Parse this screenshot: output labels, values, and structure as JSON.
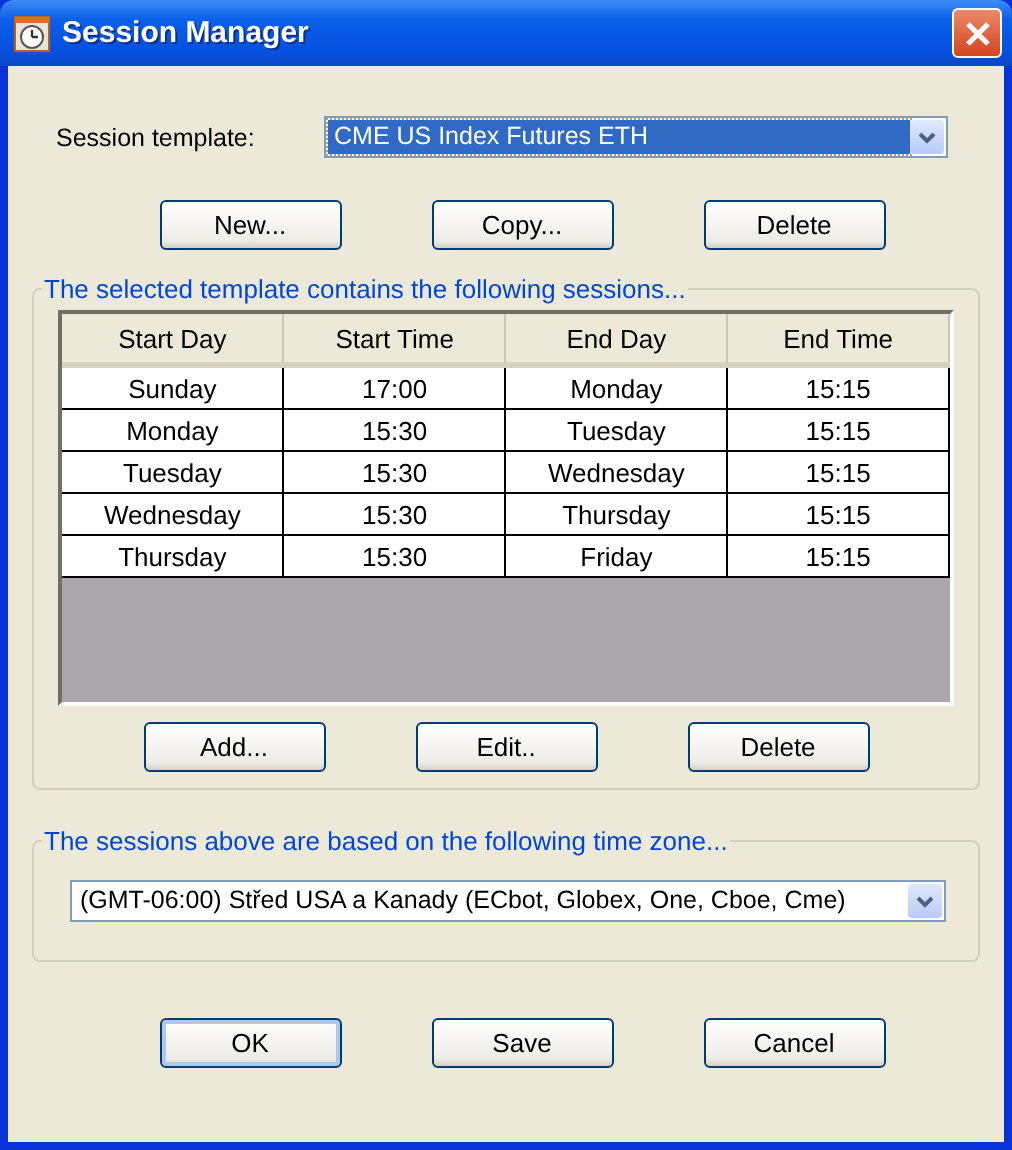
{
  "window": {
    "title": "Session Manager"
  },
  "template": {
    "label": "Session template:",
    "value": "CME US Index Futures ETH",
    "highlighted": true
  },
  "template_buttons": [
    {
      "label": "New...",
      "default": false
    },
    {
      "label": "Copy...",
      "default": false
    },
    {
      "label": "Delete",
      "default": false
    }
  ],
  "sessions_group": {
    "title": "The selected template contains the following sessions...",
    "table": {
      "columns": [
        "Start Day",
        "Start Time",
        "End Day",
        "End Time"
      ],
      "rows": [
        [
          "Sunday",
          "17:00",
          "Monday",
          "15:15"
        ],
        [
          "Monday",
          "15:30",
          "Tuesday",
          "15:15"
        ],
        [
          "Tuesday",
          "15:30",
          "Wednesday",
          "15:15"
        ],
        [
          "Wednesday",
          "15:30",
          "Thursday",
          "15:15"
        ],
        [
          "Thursday",
          "15:30",
          "Friday",
          "15:15"
        ]
      ]
    },
    "buttons": [
      {
        "label": "Add...",
        "default": false
      },
      {
        "label": "Edit..",
        "default": false
      },
      {
        "label": "Delete",
        "default": false
      }
    ]
  },
  "timezone_group": {
    "title": "The sessions above are based on the following time zone...",
    "value": "(GMT-06:00) Střed USA a Kanady (ECbot, Globex, One, Cboe, Cme)"
  },
  "dialog_buttons": [
    {
      "label": "OK",
      "default": true
    },
    {
      "label": "Save",
      "default": false
    },
    {
      "label": "Cancel",
      "default": false
    }
  ]
}
